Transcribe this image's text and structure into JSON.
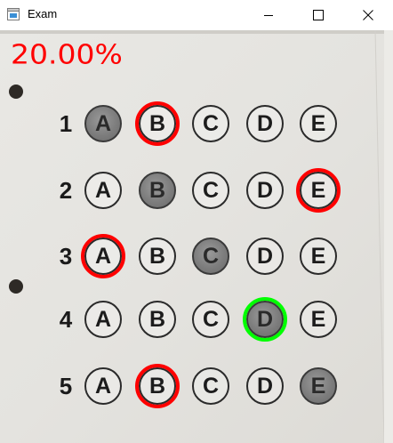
{
  "window": {
    "title": "Exam",
    "icons": {
      "app": "app-window-icon",
      "minimize": "minimize-icon",
      "maximize": "maximize-icon",
      "close": "close-icon"
    }
  },
  "result": {
    "score_text": "20.00%",
    "score_color": "#ff0000"
  },
  "colors": {
    "wrong_ring": "#ff0000",
    "correct_ring": "#00ff00",
    "filled_bubble": "#808080"
  },
  "options": [
    "A",
    "B",
    "C",
    "D",
    "E"
  ],
  "questions": [
    {
      "number": "1",
      "marked": "A",
      "answer_key": "B",
      "result": "incorrect"
    },
    {
      "number": "2",
      "marked": "B",
      "answer_key": "E",
      "result": "incorrect"
    },
    {
      "number": "3",
      "marked": "C",
      "answer_key": "A",
      "result": "incorrect"
    },
    {
      "number": "4",
      "marked": "D",
      "answer_key": "D",
      "result": "correct"
    },
    {
      "number": "5",
      "marked": "E",
      "answer_key": "B",
      "result": "incorrect"
    }
  ]
}
